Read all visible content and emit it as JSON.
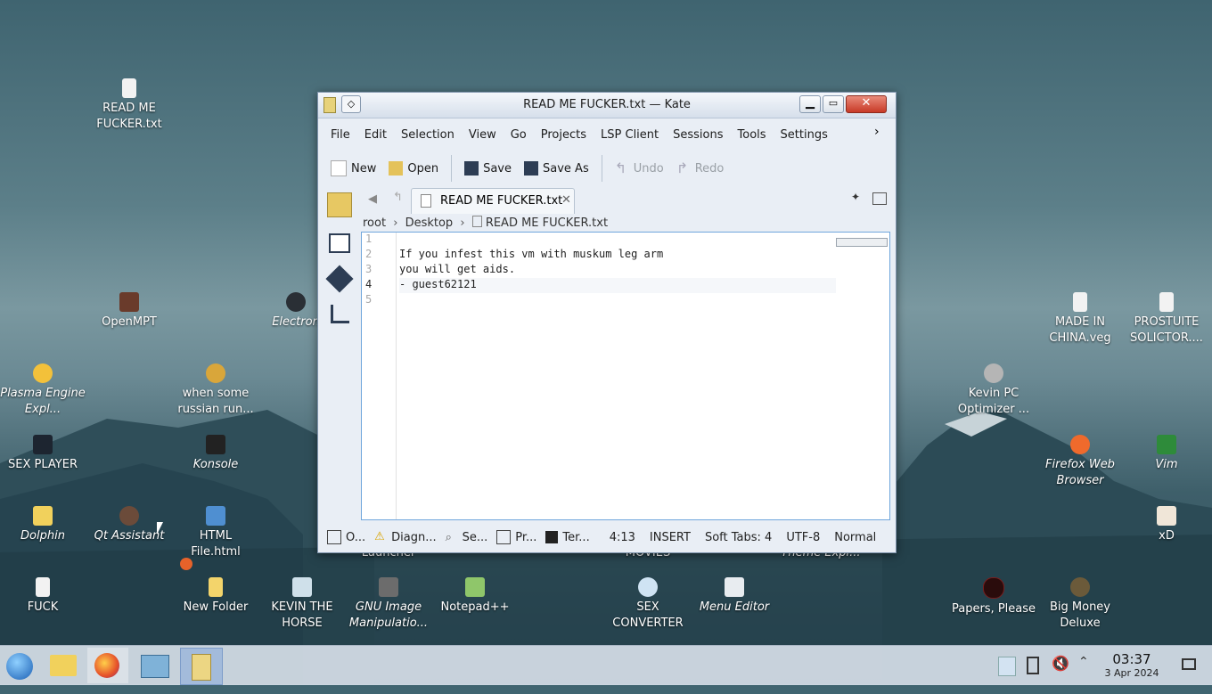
{
  "desktop_icons": [
    {
      "label": "READ ME FUCKER.txt",
      "italic": false
    },
    {
      "label": "OpenMPT",
      "italic": false
    },
    {
      "label": "Electron",
      "italic": true
    },
    {
      "label": "Plasma Engine Expl...",
      "italic": true
    },
    {
      "label": "when some russian run...",
      "italic": false
    },
    {
      "label": "SEX PLAYER",
      "italic": false
    },
    {
      "label": "Konsole",
      "italic": true
    },
    {
      "label": "Dolphin",
      "italic": true
    },
    {
      "label": "Qt Assistant",
      "italic": true
    },
    {
      "label": "HTML File.html",
      "italic": false
    },
    {
      "label": "FUCK",
      "italic": false
    },
    {
      "label": "New Folder",
      "italic": false
    },
    {
      "label": "KEVIN THE HORSE",
      "italic": false
    },
    {
      "label": "GNU Image Manipulatio...",
      "italic": true
    },
    {
      "label": "Notepad++",
      "italic": false
    },
    {
      "label": "Launcher",
      "italic": false
    },
    {
      "label": "MOVIES",
      "italic": false
    },
    {
      "label": "Theme Expl...",
      "italic": true
    },
    {
      "label": "SEX CONVERTER",
      "italic": false
    },
    {
      "label": "Menu Editor",
      "italic": true
    },
    {
      "label": "MADE IN CHINA.veg",
      "italic": false
    },
    {
      "label": "PROSTUITE SOLICTOR....",
      "italic": false
    },
    {
      "label": "Kevin PC Optimizer ...",
      "italic": false
    },
    {
      "label": "Firefox Web Browser",
      "italic": true
    },
    {
      "label": "Vim",
      "italic": true
    },
    {
      "label": "xD",
      "italic": false
    },
    {
      "label": "Papers, Please",
      "italic": false
    },
    {
      "label": "Big Money Deluxe",
      "italic": false
    }
  ],
  "window": {
    "title": "READ ME FUCKER.txt — Kate",
    "menu": [
      "File",
      "Edit",
      "Selection",
      "View",
      "Go",
      "Projects",
      "LSP Client",
      "Sessions",
      "Tools",
      "Settings"
    ],
    "toolbar": {
      "new": "New",
      "open": "Open",
      "save": "Save",
      "save_as": "Save As",
      "undo": "Undo",
      "redo": "Redo"
    },
    "tab_label": "READ ME FUCKER.txt",
    "breadcrumb": {
      "root": "root",
      "desktop": "Desktop",
      "file": "READ ME FUCKER.txt"
    },
    "lines": [
      "",
      "If you infest this vm with muskum leg arm",
      "you will get aids.",
      "- guest62121",
      ""
    ],
    "line_numbers": [
      "1",
      "2",
      "3",
      "4",
      "5"
    ],
    "current_line": 4,
    "status": {
      "output": "O...",
      "diagnostics": "Diagn...",
      "search": "Se...",
      "projects": "Pr...",
      "terminal": "Ter...",
      "cursor": "4:13",
      "mode": "INSERT",
      "tabs": "Soft Tabs: 4",
      "encoding": "UTF-8",
      "syntax": "Normal"
    }
  },
  "clock": {
    "time": "03:37",
    "date": "3 Apr 2024"
  }
}
